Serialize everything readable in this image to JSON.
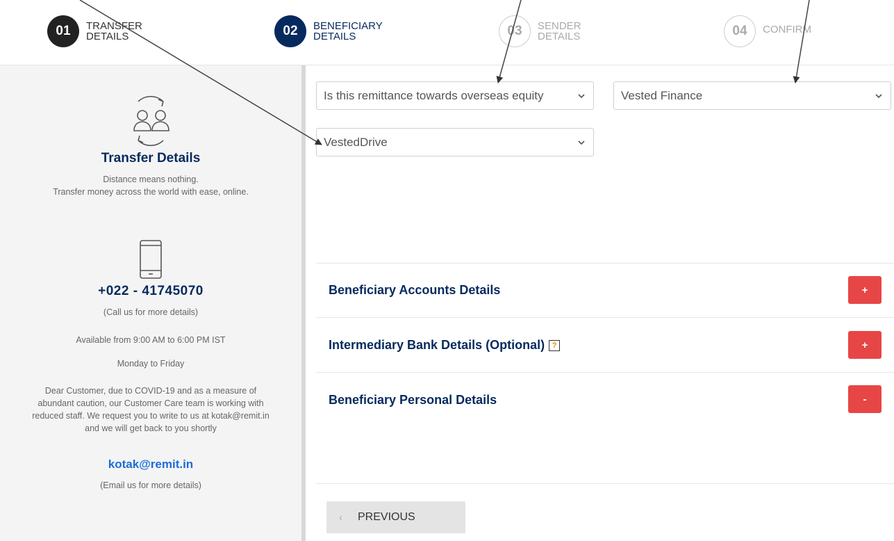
{
  "steps": [
    {
      "number": "01",
      "label_line1": "TRANSFER",
      "label_line2": "DETAILS",
      "state": "done"
    },
    {
      "number": "02",
      "label_line1": "BENEFICIARY",
      "label_line2": "DETAILS",
      "state": "active"
    },
    {
      "number": "03",
      "label_line1": "SENDER",
      "label_line2": "DETAILS",
      "state": "pending"
    },
    {
      "number": "04",
      "label_line1": "CONFIRM",
      "label_line2": "",
      "state": "pending"
    }
  ],
  "sidebar": {
    "transfer_icon": "users-exchange-icon",
    "title": "Transfer Details",
    "tagline1": "Distance means nothing.",
    "tagline2": "Transfer money across the world with ease, online.",
    "phone_icon": "mobile-phone-icon",
    "phone": "+022 - 41745070",
    "call_note": "(Call us for more details)",
    "hours": "Available from 9:00 AM to 6:00 PM IST",
    "days": "Monday to Friday",
    "covid_line1": "Dear Customer, due to COVID-19 and as a measure of",
    "covid_line2": "abundant caution, our Customer Care team is working with",
    "covid_line3": "reduced staff. We request you to write to us at kotak@remit.in",
    "covid_line4": "and we will get back to you shortly",
    "email": "kotak@remit.in",
    "email_note": "(Email us for more details)"
  },
  "form": {
    "remittance_select": "Is this remittance towards overseas equity",
    "partner_select": "Vested Finance",
    "product_select": "VestedDrive"
  },
  "sections": {
    "accounts": {
      "title": "Beneficiary Accounts Details",
      "toggle": "+"
    },
    "intermediary": {
      "title": "Intermediary Bank Details (Optional)",
      "toggle": "+",
      "help": "?"
    },
    "personal": {
      "title": "Beneficiary Personal Details",
      "toggle": "-"
    }
  },
  "nav": {
    "previous": "PREVIOUS"
  },
  "colors": {
    "navy": "#062a5e",
    "red": "#e74646",
    "link": "#1a6dd9"
  }
}
